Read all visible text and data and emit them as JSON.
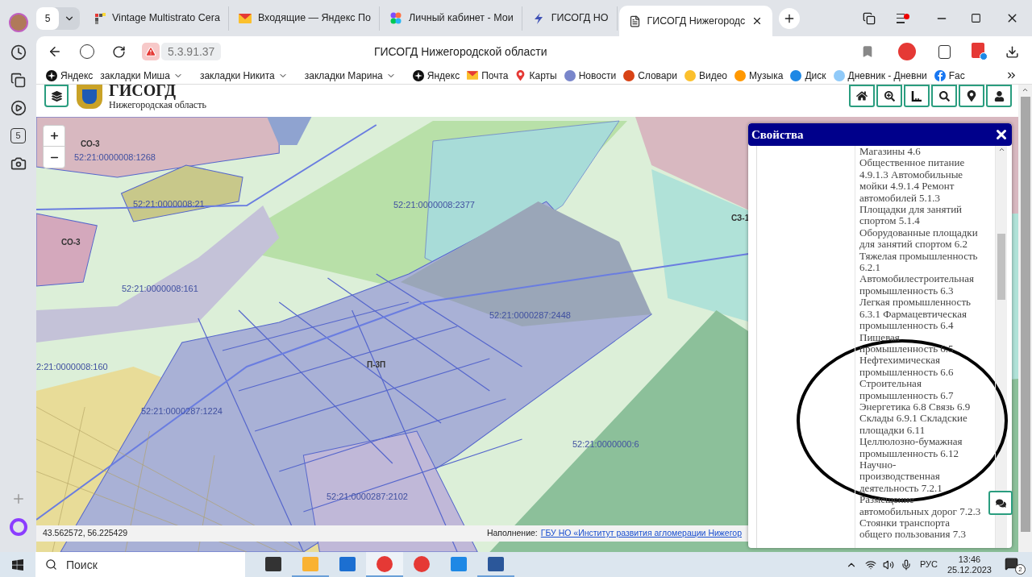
{
  "browser": {
    "tab_count": "5",
    "tabs": [
      {
        "kind": "tiles",
        "title": "Vintage Multistrato Cera",
        "selected": false
      },
      {
        "kind": "mail",
        "title": "Входящие — Яндекс По",
        "selected": false
      },
      {
        "kind": "dots",
        "title": "Личный кабинет - Мои",
        "selected": false
      },
      {
        "kind": "bolt",
        "title": "ГИСОГД НО",
        "selected": false
      },
      {
        "kind": "page",
        "title": "ГИСОГД Нижегородс",
        "selected": true
      }
    ],
    "address": "5.3.91.37",
    "page_title": "ГИСОГД Нижегородской области",
    "bookmarks": [
      {
        "kind": "yandex",
        "label": "Яндекс"
      },
      {
        "kind": "folder",
        "label": "закладки Миша"
      },
      {
        "kind": "folder",
        "label": "закладки Никита"
      },
      {
        "kind": "folder",
        "label": "закладки Марина"
      },
      {
        "kind": "yandex",
        "label": "Яндекс"
      },
      {
        "kind": "mail",
        "label": "Почта"
      },
      {
        "kind": "pin",
        "label": "Карты"
      },
      {
        "kind": "news",
        "label": "Новости"
      },
      {
        "kind": "dict",
        "label": "Словари"
      },
      {
        "kind": "video",
        "label": "Видео"
      },
      {
        "kind": "music",
        "label": "Музыка"
      },
      {
        "kind": "disk",
        "label": "Диск"
      },
      {
        "kind": "diary",
        "label": "Дневник - Дневни"
      },
      {
        "kind": "facebook",
        "label": "Fac"
      }
    ],
    "sidebar_badge": "5"
  },
  "site": {
    "title": "ГИСОГД",
    "subtitle": "Нижегородская область"
  },
  "map": {
    "labels": [
      {
        "kind": "zone",
        "text": "СО-3"
      },
      {
        "kind": "parcel",
        "text": "52:21:0000008:1268"
      },
      {
        "kind": "parcel",
        "text": "52:21:0000008:21"
      },
      {
        "kind": "parcel",
        "text": "52:21:0000008:2377"
      },
      {
        "kind": "zone",
        "text": "СО-3"
      },
      {
        "kind": "parcel",
        "text": "52:21:0000008:161"
      },
      {
        "kind": "parcel",
        "text": "2:21:0000008:160"
      },
      {
        "kind": "parcel",
        "text": "52:21:0000287:2448"
      },
      {
        "kind": "zone",
        "text": "П-3П"
      },
      {
        "kind": "parcel",
        "text": "52:21:0000287:1224"
      },
      {
        "kind": "parcel",
        "text": "52:21:0000000:6"
      },
      {
        "kind": "parcel",
        "text": "52:21:0000287:2102"
      },
      {
        "kind": "zone",
        "text": "СЗ-1"
      }
    ]
  },
  "properties": {
    "title": "Свойства",
    "lines": [
      "Магазины 4.6",
      "Общественное питание",
      "4.9.1.3 Автомобильные",
      "мойки 4.9.1.4 Ремонт",
      "автомобилей 5.1.3",
      "Площадки для занятий",
      "спортом 5.1.4",
      "Оборудованные площадки",
      "для занятий спортом 6.2",
      "Тяжелая промышленность",
      "6.2.1",
      "Автомобилестроительная",
      "промышленность 6.3",
      "Легкая промышленность",
      "6.3.1 Фармацевтическая",
      "промышленность 6.4",
      "Пищевая",
      "промышленность 6.5",
      "Нефтехимическая",
      "промышленность 6.6",
      "Строительная",
      "промышленность 6.7",
      "Энергетика 6.8 Связь 6.9",
      "Склады 6.9.1 Складские",
      "площадки 6.11",
      "Целлюлозно-бумажная",
      "промышленность 6.12",
      "Научно-",
      "производственная",
      "деятельность 7.2.1",
      "Размещение",
      "автомобильных дорог 7.2.3",
      "Стоянки транспорта",
      "общего пользования 7.3"
    ]
  },
  "status_bar": {
    "coords": "43.562572, 56.225429",
    "credit_label": "Наполнение:",
    "credit_link": "ГБУ НО «Институт развития агломерации Нижегор"
  },
  "taskbar": {
    "search_placeholder": "Поиск",
    "apps": [
      {
        "kind": "taskview",
        "open": false,
        "selected": false
      },
      {
        "kind": "explorer",
        "open": true,
        "selected": false
      },
      {
        "kind": "store",
        "open": false,
        "selected": false
      },
      {
        "kind": "browser",
        "open": true,
        "selected": true
      },
      {
        "kind": "yandex",
        "open": false,
        "selected": false
      },
      {
        "kind": "mail",
        "open": false,
        "selected": false
      },
      {
        "kind": "word",
        "open": true,
        "selected": false
      }
    ],
    "language": "РУС",
    "time": "13:46",
    "date": "25.12.2023",
    "notifications": "2"
  }
}
